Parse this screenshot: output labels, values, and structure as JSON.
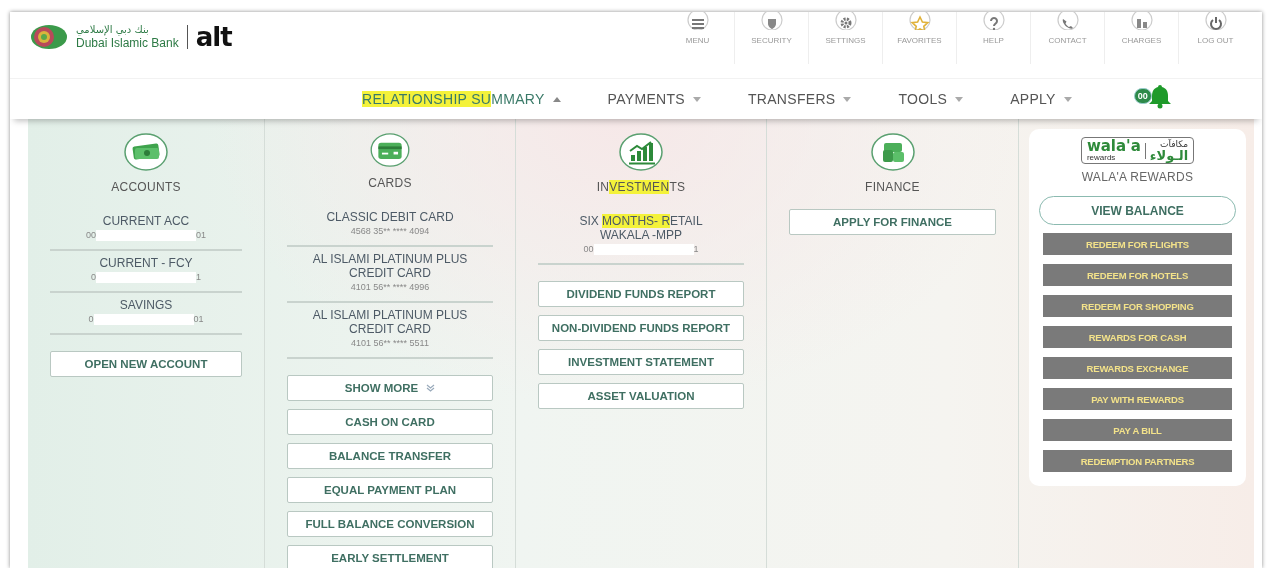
{
  "logo": {
    "arabic": "بنك دبي الإسلامي",
    "name": "Dubai Islamic Bank",
    "brand": "alt"
  },
  "top_links": [
    {
      "kind": "menu",
      "label": "MENU"
    },
    {
      "kind": "security",
      "label": "SECURITY"
    },
    {
      "kind": "settings",
      "label": "SETTINGS"
    },
    {
      "kind": "favorites",
      "label": "FAVORITES"
    },
    {
      "kind": "help",
      "label": "HELP"
    },
    {
      "kind": "contact",
      "label": "CONTACT"
    },
    {
      "kind": "charges",
      "label": "CHARGES"
    },
    {
      "kind": "logout",
      "label": "LOG OUT"
    }
  ],
  "nav": [
    {
      "parts": [
        {
          "text": "RELATIONSHIP SU",
          "highlighted": true
        },
        {
          "text": "MMARY",
          "highlighted": false
        }
      ],
      "expanded": true
    },
    {
      "parts": [
        {
          "text": "PAYMENTS",
          "highlighted": false
        }
      ],
      "expanded": false
    },
    {
      "parts": [
        {
          "text": "TRANSFERS",
          "highlighted": false
        }
      ],
      "expanded": false
    },
    {
      "parts": [
        {
          "text": "TOOLS",
          "highlighted": false
        }
      ],
      "expanded": false
    },
    {
      "parts": [
        {
          "text": "APPLY",
          "highlighted": false
        }
      ],
      "expanded": false
    }
  ],
  "notifications": {
    "count": "00"
  },
  "columns": [
    {
      "kind": "accounts",
      "title": [
        {
          "text": "ACCOUNTS",
          "highlighted": false
        }
      ],
      "items": [
        {
          "name": [
            {
              "text": "CURRENT ACC",
              "highlighted": false
            }
          ],
          "number_start": "00",
          "number_end": "01",
          "redacted": true
        },
        {
          "name": [
            {
              "text": "CURRENT - FCY",
              "highlighted": false
            }
          ],
          "number_start": "0",
          "number_end": "1",
          "redacted": true
        },
        {
          "name": [
            {
              "text": "SAVINGS",
              "highlighted": false
            }
          ],
          "number_start": "0",
          "number_end": "01",
          "redacted": true
        }
      ],
      "buttons": [
        {
          "label": "OPEN NEW ACCOUNT",
          "kind": "plain"
        }
      ]
    },
    {
      "kind": "cards",
      "title": [
        {
          "text": "CARDS",
          "highlighted": false
        }
      ],
      "items": [
        {
          "name": [
            {
              "text": "CLASSIC DEBIT CARD",
              "highlighted": false
            }
          ],
          "number_start": "4568 35** **** 4094"
        },
        {
          "name": [
            {
              "text": "AL ISLAMI PLATINUM PLUS CREDIT CARD",
              "highlighted": false
            }
          ],
          "number_start": "4101 56** **** 4996"
        },
        {
          "name": [
            {
              "text": "AL ISLAMI PLATINUM PLUS CREDIT CARD",
              "highlighted": false
            }
          ],
          "number_start": "4101 56** **** 5511"
        }
      ],
      "buttons": [
        {
          "label": "SHOW MORE",
          "kind": "more"
        },
        {
          "label": "CASH ON CARD",
          "kind": "plain"
        },
        {
          "label": "BALANCE TRANSFER",
          "kind": "plain"
        },
        {
          "label": "EQUAL PAYMENT PLAN",
          "kind": "plain"
        },
        {
          "label": "FULL BALANCE CONVERSION",
          "kind": "plain"
        },
        {
          "label": "EARLY SETTLEMENT",
          "kind": "plain"
        }
      ]
    },
    {
      "kind": "investments",
      "title": [
        {
          "text": "IN",
          "highlighted": false
        },
        {
          "text": "VESTMEN",
          "highlighted": true
        },
        {
          "text": "TS",
          "highlighted": false
        }
      ],
      "items": [
        {
          "name": [
            {
              "text": "SIX ",
              "highlighted": false
            },
            {
              "text": "MONTHS- R",
              "highlighted": true
            },
            {
              "text": "ETAIL WAKALA -MPP",
              "highlighted": false
            }
          ],
          "number_start": "00",
          "number_end": "1",
          "redacted": true
        }
      ],
      "buttons": [
        {
          "label": "DIVIDEND FUNDS REPORT",
          "kind": "plain"
        },
        {
          "label": "NON-DIVIDEND FUNDS REPORT",
          "kind": "plain"
        },
        {
          "label": "INVESTMENT STATEMENT",
          "kind": "plain"
        },
        {
          "label": "ASSET VALUATION",
          "kind": "plain"
        }
      ]
    },
    {
      "kind": "finance",
      "title": [
        {
          "text": "FINANCE",
          "highlighted": false
        }
      ],
      "buttons": [
        {
          "label": "APPLY FOR FINANCE",
          "kind": "plain"
        }
      ]
    }
  ],
  "rewards": {
    "logo_latin": "wala'a",
    "logo_sub": "rewards",
    "logo_arabic": "الـولاء",
    "logo_arabic_top": "مكافآت",
    "title": "WALA'A REWARDS",
    "balance_button": "VIEW BALANCE",
    "actions": [
      "REDEEM FOR FLIGHTS",
      "REDEEM FOR HOTELS",
      "REDEEM FOR SHOPPING",
      "REWARDS FOR CASH",
      "REWARDS EXCHANGE",
      "PAY WITH REWARDS",
      "PAY A BILL",
      "REDEMPTION PARTNERS"
    ]
  }
}
